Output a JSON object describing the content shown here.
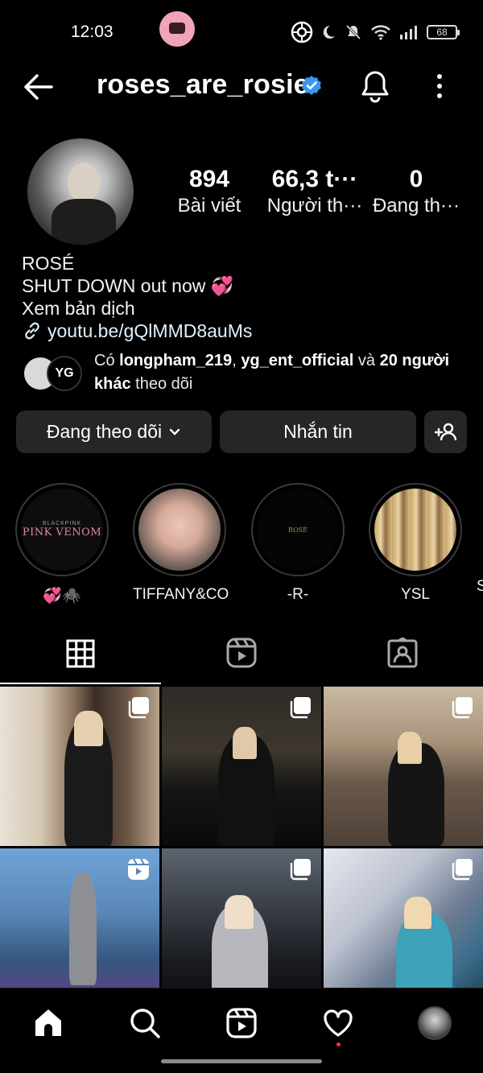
{
  "status_bar": {
    "time": "12:03",
    "battery": "68"
  },
  "header": {
    "username": "roses_are_rosie"
  },
  "stats": [
    {
      "value": "894",
      "label": "Bài viết"
    },
    {
      "value": "66,3 t···",
      "label": "Người th···"
    },
    {
      "value": "0",
      "label": "Đang th···"
    }
  ],
  "bio": {
    "name": "ROSÉ",
    "line1": "SHUT DOWN out now 💞",
    "translate": "Xem bản dịch",
    "link": "youtu.be/gQlMMD8auMs"
  },
  "followed_by": {
    "prefix": "Có",
    "user1": "longpham_219",
    "user2": "yg_ent_official",
    "conj": "và",
    "others": "20 người",
    "others2": "khác",
    "suffix": "theo dõi",
    "badge_text": "YG"
  },
  "buttons": {
    "following": "Đang theo dõi",
    "message": "Nhắn tin"
  },
  "highlights": [
    {
      "label": "💞🕷️",
      "cover_small": "BLACKPINK",
      "cover_big": "PINK VENOM"
    },
    {
      "label": "TIFFANY&CO"
    },
    {
      "label": "-R-",
      "cover_text": "ROSÉ"
    },
    {
      "label": "YSL"
    },
    {
      "label": "S"
    }
  ],
  "posts": [
    {
      "type": "multiple"
    },
    {
      "type": "multiple"
    },
    {
      "type": "multiple"
    },
    {
      "type": "reel"
    },
    {
      "type": "multiple"
    },
    {
      "type": "multiple"
    }
  ],
  "icons": {
    "back": "arrow-left-icon",
    "verified": "verified-badge-icon",
    "bell": "bell-icon",
    "more": "more-vertical-icon",
    "grid": "grid-icon",
    "reels": "reels-icon",
    "tagged": "tagged-icon",
    "home": "home-icon",
    "search": "search-icon",
    "heart": "heart-icon"
  },
  "colors": {
    "background": "#000000",
    "button_bg": "#262626",
    "verified": "#3897f0",
    "notification_dot": "#ff3040"
  }
}
